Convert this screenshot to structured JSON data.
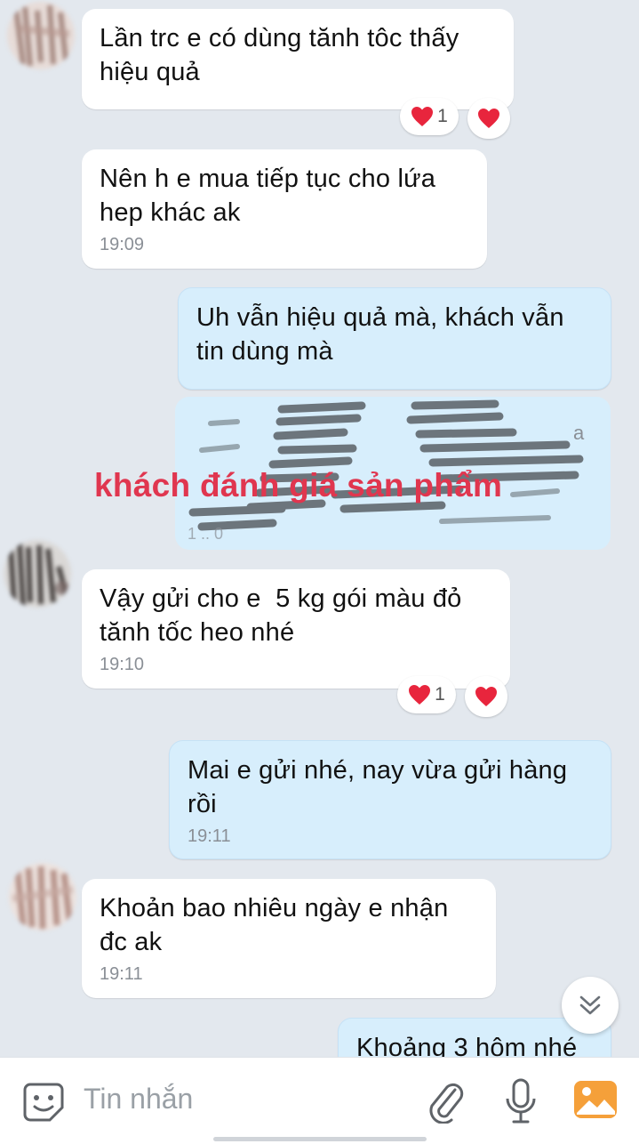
{
  "messages": [
    {
      "text": "Lần trc e có dùng tănh tôc thấy\nhiệu quả",
      "time": ""
    },
    {
      "text": "Nên h e mua tiếp tục cho lứa\nhep khác ak",
      "time": "19:09"
    },
    {
      "text": "Uh vẫn hiệu quả mà, khách vẫn\ntin dùng mà",
      "time": ""
    },
    {
      "text": "Vậy gửi cho e  5 kg gói màu đỏ\ntănh tốc heo nhé",
      "time": "19:10"
    },
    {
      "text": "Mai e gửi nhé, nay vừa gửi hàng\nrồi",
      "time": "19:11"
    },
    {
      "text": "Khoản bao nhiêu ngày e nhận\nđc ak",
      "time": "19:11"
    },
    {
      "text": "Khoảng 3 hôm nhé",
      "time": ""
    }
  ],
  "reactions": [
    {
      "emoji": "heart",
      "count": "1"
    },
    {
      "emoji": "heart",
      "count": "1"
    }
  ],
  "image_overlay_text": "khách đánh giá sản phẩm",
  "composer": {
    "placeholder": "Tin nhắn"
  },
  "icons": {
    "emoji": "sticker-emoji-icon",
    "attach": "paperclip-icon",
    "mic": "microphone-icon",
    "image": "image-gallery-icon",
    "scroll": "double-chevron-down-icon",
    "heart": "heart-icon"
  },
  "colors": {
    "background": "#e3e8ee",
    "incoming_bubble": "#ffffff",
    "outgoing_bubble": "#d7eefc",
    "heart": "#e8253d",
    "overlay_text": "#e0364f",
    "image_icon": "#f5a03a"
  }
}
